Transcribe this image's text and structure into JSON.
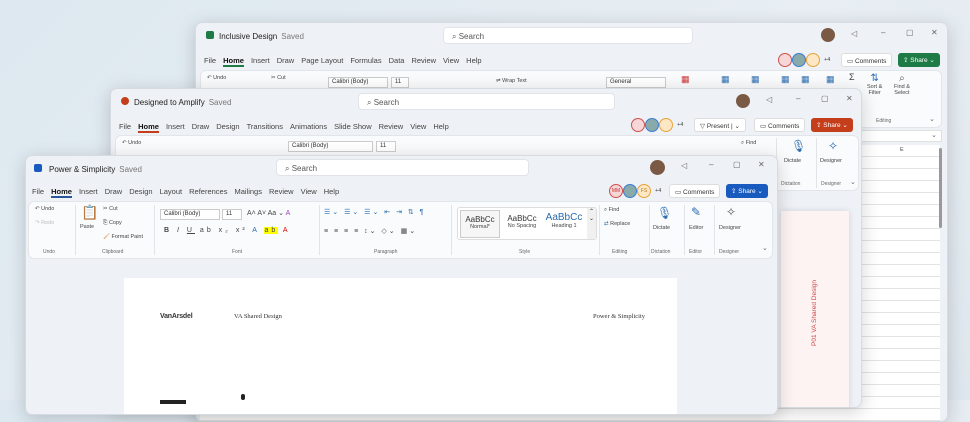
{
  "excel": {
    "title": "Inclusive Design",
    "status": "Saved",
    "search": "Search",
    "tabs": [
      "File",
      "Home",
      "Insert",
      "Draw",
      "Page Layout",
      "Formulas",
      "Data",
      "Review",
      "View",
      "Help"
    ],
    "collab_extra": "+4",
    "comments": "Comments",
    "share": "Share",
    "undo": "Undo",
    "cut": "Cut",
    "font": "Calibri (Body)",
    "size": "11",
    "wrap": "Wrap Text",
    "format": "General",
    "sort": "Sort &\nFilter",
    "find": "Find &\nSelect",
    "editing": "Editing",
    "col": "E",
    "accent": "#1e7b45"
  },
  "ppt": {
    "title": "Designed to Amplify",
    "status": "Saved",
    "search": "Search",
    "tabs": [
      "File",
      "Home",
      "Insert",
      "Draw",
      "Design",
      "Transitions",
      "Animations",
      "Slide Show",
      "Review",
      "View",
      "Help"
    ],
    "collab_extra": "+4",
    "present": "Present",
    "comments": "Comments",
    "share": "Share",
    "undo": "Undo",
    "font": "Calibri (Body)",
    "size": "11",
    "find": "Find",
    "dictate": "Dictate",
    "designer": "Designer",
    "dictation": "Dictation",
    "designer_grp": "Designer",
    "slide_text": "P01   VA Shared Design",
    "accent": "#c43e1c"
  },
  "word": {
    "title": "Power & Simplicity",
    "status": "Saved",
    "search": "Search",
    "tabs": [
      "File",
      "Home",
      "Insert",
      "Draw",
      "Design",
      "Layout",
      "References",
      "Mailings",
      "Review",
      "View",
      "Help"
    ],
    "collab": [
      "MM",
      "FS"
    ],
    "collab_extra": "+4",
    "comments": "Comments",
    "share": "Share",
    "accent": "#185abd",
    "ribbon": {
      "undo": "Undo",
      "redo": "Redo",
      "paste": "Paste",
      "cut": "Cut",
      "copy": "Copy",
      "format_paint": "Format Paint",
      "font": "Calibri (Body)",
      "size": "11",
      "styles": [
        {
          "sample": "AaBbCc",
          "name": "Normal*"
        },
        {
          "sample": "AaBbCc",
          "name": "No Spacing"
        },
        {
          "sample": "AaBbCc",
          "name": "Heading 1"
        }
      ],
      "find": "Find",
      "replace": "Replace",
      "dictate": "Dictate",
      "editor": "Editor",
      "designer": "Designer",
      "groups": {
        "undo": "Undo",
        "clipboard": "Clipboard",
        "font": "Font",
        "paragraph": "Paragraph",
        "style": "Style",
        "editing": "Editing",
        "dictation": "Dictation",
        "editor": "Editor",
        "designer": "Designer"
      }
    },
    "doc": {
      "logo": "VanArsdel",
      "header": "VA Shared Design",
      "right": "Power & Simplicity"
    }
  }
}
